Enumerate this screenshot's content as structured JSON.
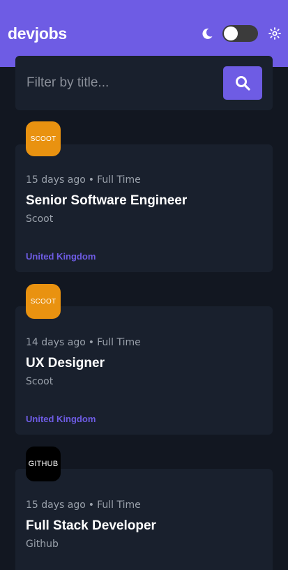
{
  "header": {
    "brand": "devjobs",
    "theme_toggle_on": false,
    "accent_color": "#6e5ce4"
  },
  "search": {
    "placeholder": "Filter by title...",
    "value": "",
    "button_icon": "search-icon"
  },
  "jobs": [
    {
      "logo_text": "SCOOT",
      "logo_color": "#e99210",
      "posted": "15 days ago",
      "separator": "•",
      "contract": "Full Time",
      "title": "Senior Software Engineer",
      "company": "Scoot",
      "location": "United Kingdom"
    },
    {
      "logo_text": "SCOOT",
      "logo_color": "#e99210",
      "posted": "14 days ago",
      "separator": "•",
      "contract": "Full Time",
      "title": "UX Designer",
      "company": "Scoot",
      "location": "United Kingdom"
    },
    {
      "logo_text": "GITHUB",
      "logo_color": "#000000",
      "posted": "15 days ago",
      "separator": "•",
      "contract": "Full Time",
      "title": "Full Stack Developer",
      "company": "Github",
      "location": ""
    }
  ]
}
